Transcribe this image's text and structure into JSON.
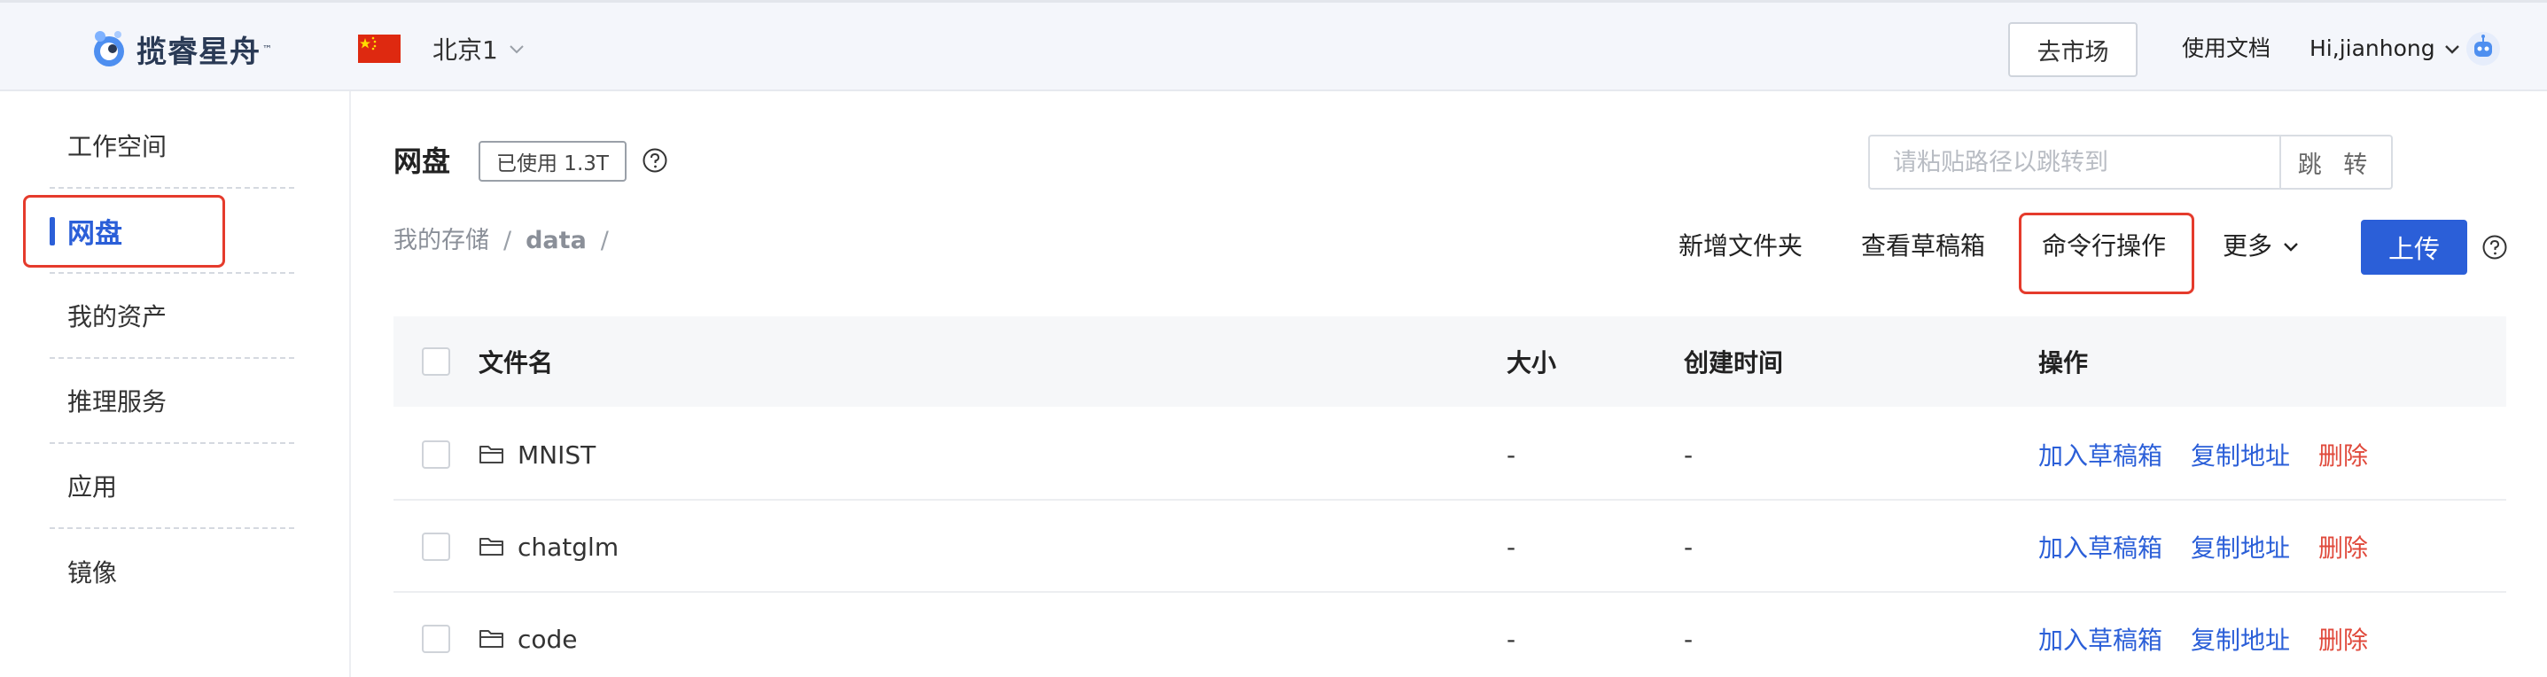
{
  "app": {
    "logo_text": "揽睿星舟",
    "logo_tm": "™"
  },
  "header": {
    "region": "北京1",
    "market_button": "去市场",
    "docs_link": "使用文档",
    "user_greeting": "Hi,jianhong"
  },
  "sidebar": {
    "items": [
      {
        "label": "工作空间"
      },
      {
        "label": "网盘"
      },
      {
        "label": "我的资产"
      },
      {
        "label": "推理服务"
      },
      {
        "label": "应用"
      },
      {
        "label": "镜像"
      }
    ],
    "active_index": 1
  },
  "main": {
    "title": "网盘",
    "usage": "已使用 1.3T",
    "path_placeholder": "请粘贴路径以跳转到",
    "jump_label": "跳 转",
    "breadcrumb": {
      "root": "我的存储",
      "sep": "/",
      "current": "data",
      "trail": "/"
    },
    "toolbar": {
      "new_folder": "新增文件夹",
      "view_drafts": "查看草稿箱",
      "cli": "命令行操作",
      "more": "更多",
      "upload": "上传"
    }
  },
  "table": {
    "columns": {
      "name": "文件名",
      "size": "大小",
      "created": "创建时间",
      "actions": "操作"
    },
    "rows": [
      {
        "name": "MNIST",
        "size": "-",
        "created": "-",
        "add_draft": "加入草稿箱",
        "copy_addr": "复制地址",
        "delete": "删除"
      },
      {
        "name": "chatglm",
        "size": "-",
        "created": "-",
        "add_draft": "加入草稿箱",
        "copy_addr": "复制地址",
        "delete": "删除"
      },
      {
        "name": "code",
        "size": "-",
        "created": "-",
        "add_draft": "加入草稿箱",
        "copy_addr": "复制地址",
        "delete": "删除"
      }
    ]
  },
  "colors": {
    "accent": "#2b5fd8",
    "danger": "#e04a3c",
    "highlight": "#e53b2c"
  }
}
